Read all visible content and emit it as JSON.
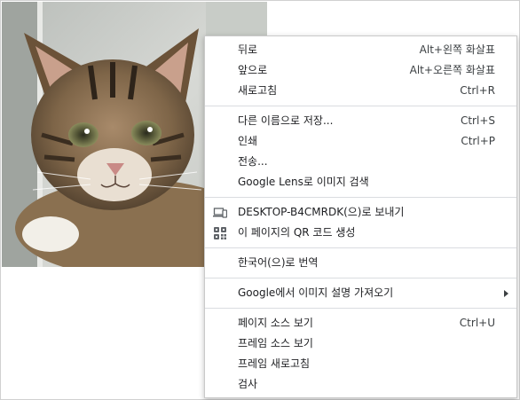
{
  "photo": {
    "subject": "tabby-kitten-photo"
  },
  "menu": {
    "groups": [
      [
        {
          "label": "뒤로",
          "shortcut": "Alt+왼쪽 화살표"
        },
        {
          "label": "앞으로",
          "shortcut": "Alt+오른쪽 화살표"
        },
        {
          "label": "새로고침",
          "shortcut": "Ctrl+R"
        }
      ],
      [
        {
          "label": "다른 이름으로 저장...",
          "shortcut": "Ctrl+S"
        },
        {
          "label": "인쇄",
          "shortcut": "Ctrl+P"
        },
        {
          "label": "전송...",
          "shortcut": ""
        },
        {
          "label": "Google Lens로 이미지 검색",
          "shortcut": ""
        }
      ],
      [
        {
          "label": "DESKTOP-B4CMRDK(으)로 보내기",
          "shortcut": "",
          "icon": "devices-icon"
        },
        {
          "label": "이 페이지의 QR 코드 생성",
          "shortcut": "",
          "icon": "qr-code-icon"
        }
      ],
      [
        {
          "label": "한국어(으)로 번역",
          "shortcut": ""
        }
      ],
      [
        {
          "label": "Google에서 이미지 설명 가져오기",
          "shortcut": "",
          "submenu": true
        }
      ],
      [
        {
          "label": "페이지 소스 보기",
          "shortcut": "Ctrl+U"
        },
        {
          "label": "프레임 소스 보기",
          "shortcut": ""
        },
        {
          "label": "프레임 새로고침",
          "shortcut": ""
        },
        {
          "label": "검사",
          "shortcut": ""
        }
      ]
    ]
  }
}
